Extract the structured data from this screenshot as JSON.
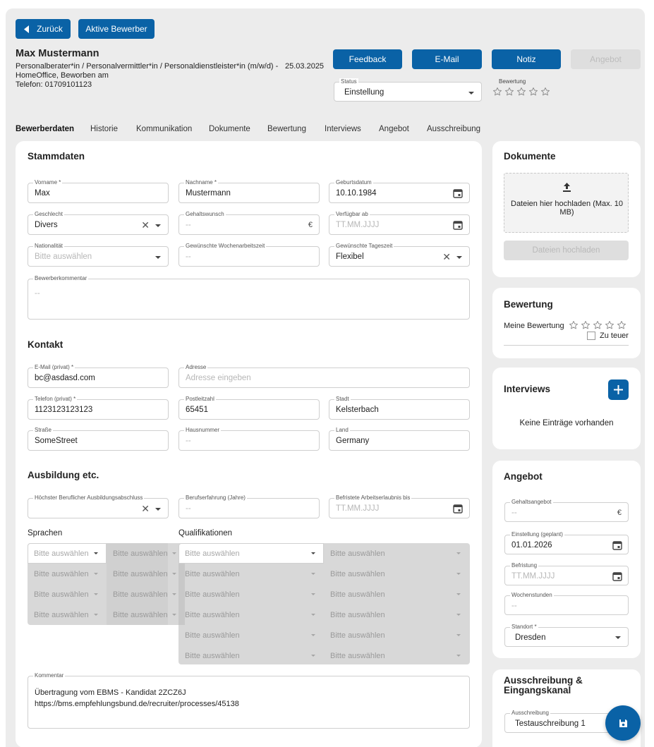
{
  "header": {
    "back_label": "Zurück",
    "active_label": "Aktive Bewerber",
    "name": "Max Mustermann",
    "position_line1": "Personalberater*in / Personalvermittler*in / Personaldienstleister*in (m/w/d) -",
    "position_line2": "HomeOffice, Beworben am",
    "date": "25.03.2025",
    "phone": "Telefon: 01709101123",
    "feedback_label": "Feedback",
    "email_label": "E-Mail",
    "note_label": "Notiz",
    "offer_label": "Angebot",
    "status_label": "Status",
    "status_value": "Einstellung",
    "rating_label": "Bewertung",
    "rating_stars": 0
  },
  "tabs": [
    "Bewerberdaten",
    "Historie",
    "Kommunikation",
    "Dokumente",
    "Bewertung",
    "Interviews",
    "Angebot",
    "Ausschreibung"
  ],
  "stammdaten": {
    "title": "Stammdaten",
    "vorname_label": "Vorname *",
    "vorname": "Max",
    "nachname_label": "Nachname *",
    "nachname": "Mustermann",
    "geburtsdatum_label": "Geburtsdatum",
    "geburtsdatum": "10.10.1984",
    "geschlecht_label": "Geschlecht",
    "geschlecht": "Divers",
    "gehalt_label": "Gehaltswunsch",
    "gehalt": "--",
    "euro": "€",
    "verfuegbar_label": "Verfügbar ab",
    "verfuegbar_ph": "TT.MM.JJJJ",
    "nationalitaet_label": "Nationalität",
    "nationalitaet_ph": "Bitte auswählen",
    "wochenarbeitszeit_label": "Gewünschte Wochenarbeitszeit",
    "wochenarbeitszeit": "--",
    "tageszeit_label": "Gewünschte Tageszeit",
    "tageszeit": "Flexibel",
    "kommentar_label": "Bewerberkommentar",
    "kommentar": "--"
  },
  "kontakt": {
    "title": "Kontakt",
    "email_label": "E-Mail (privat) *",
    "email": "bc@asdasd.com",
    "adresse_label": "Adresse",
    "adresse_ph": "Adresse eingeben",
    "telefon_label": "Telefon (privat) *",
    "telefon": "1123123123123",
    "plz_label": "Postleitzahl",
    "plz": "65451",
    "stadt_label": "Stadt",
    "stadt": "Kelsterbach",
    "strasse_label": "Straße",
    "strasse": "SomeStreet",
    "hausnummer_label": "Hausnummer",
    "hausnummer": "--",
    "land_label": "Land",
    "land": "Germany"
  },
  "ausbildung": {
    "title": "Ausbildung etc.",
    "abschluss_label": "Höchster Beruflicher Ausbildungsabschluss",
    "erfahrung_label": "Berufserfahrung (Jahre)",
    "erfahrung": "--",
    "arbeitserlaubnis_label": "Befristete Arbeitserlaubnis bis",
    "arbeitserlaubnis_ph": "TT.MM.JJJJ",
    "sprachen_label": "Sprachen",
    "qualifikationen_label": "Qualifikationen",
    "select_ph": "Bitte auswählen",
    "kommentar_label": "Kommentar",
    "kommentar_line1": "Übertragung vom EBMS - Kandidat 2ZCZ6J",
    "kommentar_line2": "https://bms.empfehlungsbund.de/recruiter/processes/45138"
  },
  "dokumente": {
    "title": "Dokumente",
    "drop_text": "Dateien hier hochladen (Max. 10 MB)",
    "upload_label": "Dateien hochladen"
  },
  "bewertung": {
    "title": "Bewertung",
    "meine_label": "Meine Bewertung",
    "zu_teuer_label": "Zu teuer"
  },
  "interviews": {
    "title": "Interviews",
    "empty_text": "Keine Einträge vorhanden"
  },
  "angebot": {
    "title": "Angebot",
    "gehaltsangebot_label": "Gehaltsangebot",
    "gehaltsangebot": "--",
    "einstellung_label": "Einstellung (geplant)",
    "einstellung": "01.01.2026",
    "befristung_label": "Befristung",
    "befristung_ph": "TT.MM.JJJJ",
    "wochenstunden_label": "Wochenstunden",
    "wochenstunden": "--",
    "standort_label": "Standort *",
    "standort": "Dresden"
  },
  "ausschreibung": {
    "title_line1": "Ausschreibung &",
    "title_line2": "Eingangskanal",
    "ausschreibung_label": "Ausschreibung",
    "ausschreibung_value": "Testauschreibung 1"
  },
  "colors": {
    "primary": "#0a62a6",
    "background": "#ececec"
  }
}
